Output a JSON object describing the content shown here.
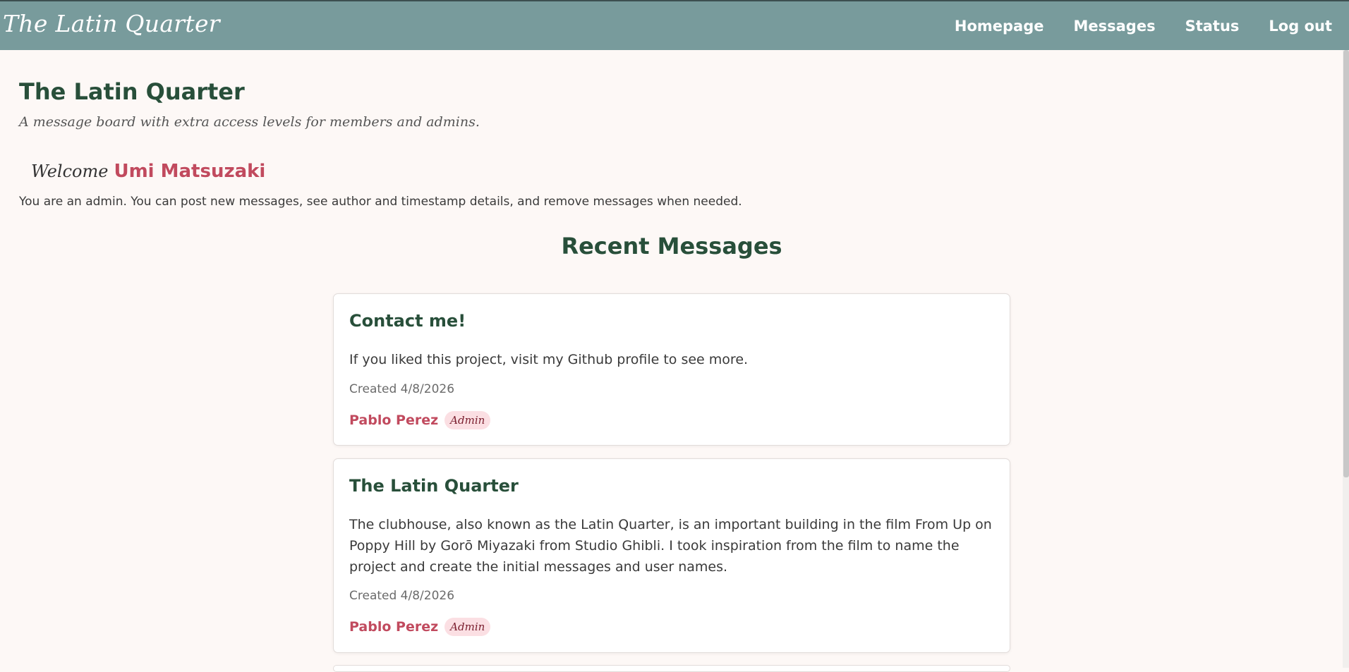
{
  "header": {
    "brand": "The Latin Quarter",
    "nav": [
      {
        "label": "Homepage"
      },
      {
        "label": "Messages"
      },
      {
        "label": "Status"
      },
      {
        "label": "Log out"
      }
    ]
  },
  "main": {
    "title": "The Latin Quarter",
    "tagline": "A message board with extra access levels for members and admins.",
    "welcome_word": "Welcome",
    "user_name": "Umi Matsuzaki",
    "role_description": "You are an admin. You can post new messages, see author and timestamp details, and remove messages when needed.",
    "section_title": "Recent Messages"
  },
  "messages": [
    {
      "title": "Contact me!",
      "body": "If you liked this project, visit my Github profile to see more.",
      "created": "Created 4/8/2026",
      "author": "Pablo Perez",
      "role": "Admin"
    },
    {
      "title": "The Latin Quarter",
      "body": "The clubhouse, also known as the Latin Quarter, is an important building in the film From Up on Poppy Hill by Gorō Miyazaki from Studio Ghibli. I took inspiration from the film to name the project and create the initial messages and user names.",
      "created": "Created 4/8/2026",
      "author": "Pablo Perez",
      "role": "Admin"
    }
  ],
  "colors": {
    "header_bg": "#789b9c",
    "page_bg": "#fdf8f6",
    "heading": "#284f3a",
    "accent": "#c14a5e",
    "badge_bg": "#fbdfe3"
  }
}
